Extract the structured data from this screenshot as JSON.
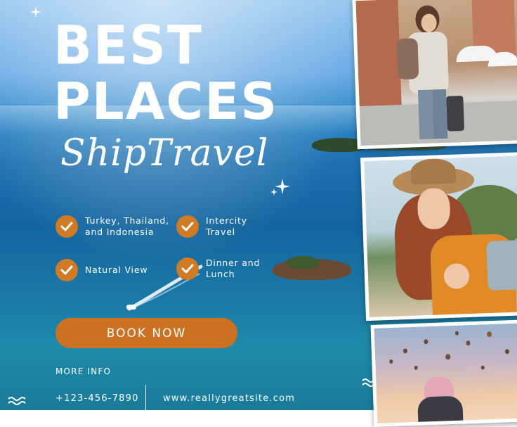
{
  "poster": {
    "title_line1": "BEST",
    "title_line2": "PLACES",
    "subtitle_script": "ShipTravel",
    "features": [
      {
        "text": "Turkey, Thailand,\nand Indonesia"
      },
      {
        "text": "Intercity\nTravel"
      },
      {
        "text": "Natural View"
      },
      {
        "text": "Dinner and\nLunch"
      }
    ],
    "book_button": "BOOK NOW",
    "more_info": "MORE INFO",
    "phone": "+123-456-7890",
    "website": "www.reallygreatsite.com"
  },
  "colors": {
    "accent": "#cc7223",
    "sea_dark": "#13659f",
    "sky": "#8ec3ee",
    "text": "#ffffff"
  },
  "icons": [
    "check-icon",
    "sparkle-icon",
    "wave-icon"
  ]
}
